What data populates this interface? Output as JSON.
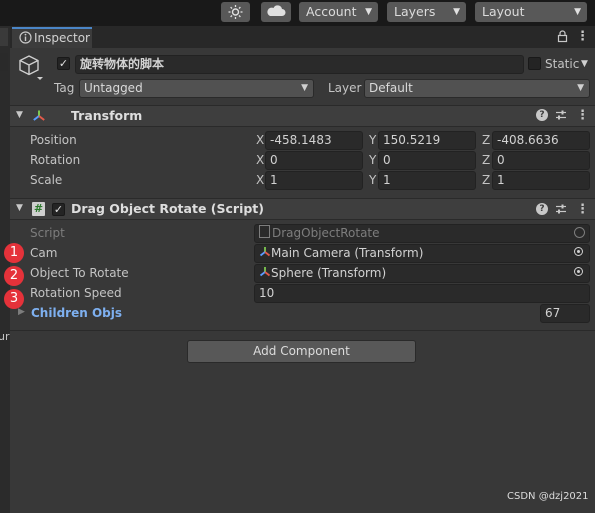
{
  "toolbar": {
    "account_label": "Account",
    "layers_label": "Layers",
    "layout_label": "Layout"
  },
  "tab": {
    "label": "Inspector"
  },
  "object": {
    "name": "旋转物体的脚本",
    "static_label": "Static",
    "tag_label": "Tag",
    "tag_value": "Untagged",
    "layer_label": "Layer",
    "layer_value": "Default"
  },
  "transform": {
    "title": "Transform",
    "rows": [
      {
        "label": "Position",
        "x": "-458.1483",
        "y": "150.5219",
        "z": "-408.6636"
      },
      {
        "label": "Rotation",
        "x": "0",
        "y": "0",
        "z": "0"
      },
      {
        "label": "Scale",
        "x": "1",
        "y": "1",
        "z": "1"
      }
    ],
    "axis": {
      "x": "X",
      "y": "Y",
      "z": "Z"
    }
  },
  "script": {
    "title": "Drag Object Rotate (Script)",
    "fields": [
      {
        "label": "Script",
        "value": "DragObjectRotate"
      },
      {
        "label": "Cam",
        "value": "Main Camera (Transform)"
      },
      {
        "label": "Object To Rotate",
        "value": "Sphere (Transform)"
      },
      {
        "label": "Rotation Speed",
        "value": "10"
      }
    ],
    "children_label": "Children Objs",
    "children_count": "67"
  },
  "add_component_label": "Add Component",
  "markers": [
    "1",
    "2",
    "3"
  ],
  "left_strip_text": "ur",
  "watermark": "CSDN @dzj2021",
  "colors": {
    "accent_blue": "#4b86c7",
    "link_blue": "#7eb0f0",
    "marker_red": "#e5323a"
  }
}
